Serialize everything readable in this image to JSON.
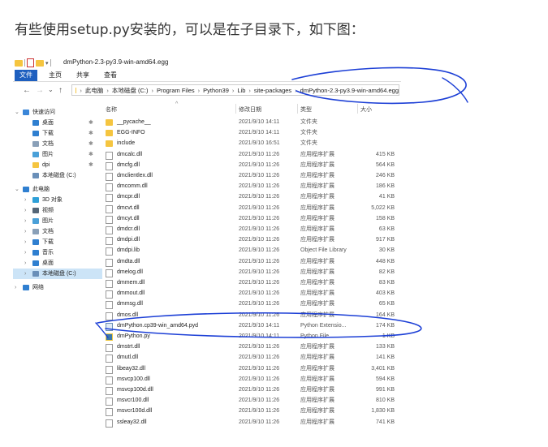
{
  "caption": "有些使用setup.py安装的，可以是在子目录下，如下图：",
  "window": {
    "title": "dmPython-2.3-py3.9-win-amd64.egg",
    "ribbon_tabs": [
      "文件",
      "主页",
      "共享",
      "查看"
    ],
    "nav_buttons": [
      "←",
      "→",
      "⌄",
      "↑"
    ],
    "breadcrumbs": [
      "此电脑",
      "本地磁盘 (C:)",
      "Program Files",
      "Python39",
      "Lib",
      "site-packages",
      "dmPython-2.3-py3.9-win-amd64.egg"
    ]
  },
  "nav_pane": [
    {
      "label": "快速访问",
      "icon": "star-icon",
      "color": "#3a86d8",
      "level": 0,
      "chev": "⌄"
    },
    {
      "label": "桌面",
      "icon": "desktop-icon",
      "color": "#2f7fd0",
      "level": 1,
      "pin": true
    },
    {
      "label": "下载",
      "icon": "download-icon",
      "color": "#2f7fd0",
      "level": 1,
      "pin": true
    },
    {
      "label": "文档",
      "icon": "document-icon",
      "color": "#8aa0b8",
      "level": 1,
      "pin": true
    },
    {
      "label": "图片",
      "icon": "pictures-icon",
      "color": "#4aa0d8",
      "level": 1,
      "pin": true
    },
    {
      "label": "dpi",
      "icon": "folder-icon",
      "color": "#f5c540",
      "level": 1,
      "pin": true
    },
    {
      "label": "本地磁盘 (C:)",
      "icon": "drive-icon",
      "color": "#6a8fb8",
      "level": 1
    },
    {
      "label": "此电脑",
      "icon": "computer-icon",
      "color": "#2f7fd0",
      "level": 0,
      "chev": "⌄"
    },
    {
      "label": "3D 对象",
      "icon": "3d-objects-icon",
      "color": "#2fa0d8",
      "level": 1,
      "chev": "›"
    },
    {
      "label": "视频",
      "icon": "video-icon",
      "color": "#556677",
      "level": 1,
      "chev": "›"
    },
    {
      "label": "图片",
      "icon": "pictures-icon",
      "color": "#4aa0d8",
      "level": 1,
      "chev": "›"
    },
    {
      "label": "文档",
      "icon": "document-icon",
      "color": "#8aa0b8",
      "level": 1,
      "chev": "›"
    },
    {
      "label": "下载",
      "icon": "download-icon",
      "color": "#2f7fd0",
      "level": 1,
      "chev": "›"
    },
    {
      "label": "音乐",
      "icon": "music-icon",
      "color": "#2f7fd0",
      "level": 1,
      "chev": "›"
    },
    {
      "label": "桌面",
      "icon": "desktop-icon",
      "color": "#2f7fd0",
      "level": 1,
      "chev": "›"
    },
    {
      "label": "本地磁盘 (C:)",
      "icon": "drive-icon",
      "color": "#6a8fb8",
      "level": 1,
      "chev": "›",
      "selected": true
    },
    {
      "label": "网络",
      "icon": "network-icon",
      "color": "#2f7fd0",
      "level": 0,
      "chev": "›"
    }
  ],
  "columns": {
    "name": "名称",
    "date": "修改日期",
    "type": "类型",
    "size": "大小"
  },
  "files": [
    {
      "name": "__pycache__",
      "date": "2021/9/10 14:11",
      "type": "文件夹",
      "size": "",
      "kind": "folder"
    },
    {
      "name": "EGG-INFO",
      "date": "2021/9/10 14:11",
      "type": "文件夹",
      "size": "",
      "kind": "folder"
    },
    {
      "name": "include",
      "date": "2021/9/10 16:51",
      "type": "文件夹",
      "size": "",
      "kind": "folder"
    },
    {
      "name": "dmcalc.dll",
      "date": "2021/9/10 11:26",
      "type": "应用程序扩展",
      "size": "415 KB",
      "kind": "file"
    },
    {
      "name": "dmcfg.dll",
      "date": "2021/9/10 11:26",
      "type": "应用程序扩展",
      "size": "564 KB",
      "kind": "file"
    },
    {
      "name": "dmclientlex.dll",
      "date": "2021/9/10 11:26",
      "type": "应用程序扩展",
      "size": "246 KB",
      "kind": "file"
    },
    {
      "name": "dmcomm.dll",
      "date": "2021/9/10 11:26",
      "type": "应用程序扩展",
      "size": "186 KB",
      "kind": "file"
    },
    {
      "name": "dmcpr.dll",
      "date": "2021/9/10 11:26",
      "type": "应用程序扩展",
      "size": "41 KB",
      "kind": "file"
    },
    {
      "name": "dmcvt.dll",
      "date": "2021/9/10 11:26",
      "type": "应用程序扩展",
      "size": "5,022 KB",
      "kind": "file"
    },
    {
      "name": "dmcyt.dll",
      "date": "2021/9/10 11:26",
      "type": "应用程序扩展",
      "size": "158 KB",
      "kind": "file"
    },
    {
      "name": "dmdcr.dll",
      "date": "2021/9/10 11:26",
      "type": "应用程序扩展",
      "size": "63 KB",
      "kind": "file"
    },
    {
      "name": "dmdpi.dll",
      "date": "2021/9/10 11:26",
      "type": "应用程序扩展",
      "size": "917 KB",
      "kind": "file"
    },
    {
      "name": "dmdpi.lib",
      "date": "2021/9/10 11:26",
      "type": "Object File Library",
      "size": "30 KB",
      "kind": "file"
    },
    {
      "name": "dmdta.dll",
      "date": "2021/9/10 11:26",
      "type": "应用程序扩展",
      "size": "448 KB",
      "kind": "file"
    },
    {
      "name": "dmelog.dll",
      "date": "2021/9/10 11:26",
      "type": "应用程序扩展",
      "size": "82 KB",
      "kind": "file"
    },
    {
      "name": "dmmem.dll",
      "date": "2021/9/10 11:26",
      "type": "应用程序扩展",
      "size": "83 KB",
      "kind": "file"
    },
    {
      "name": "dmmout.dll",
      "date": "2021/9/10 11:26",
      "type": "应用程序扩展",
      "size": "403 KB",
      "kind": "file"
    },
    {
      "name": "dmmsg.dll",
      "date": "2021/9/10 11:26",
      "type": "应用程序扩展",
      "size": "65 KB",
      "kind": "file"
    },
    {
      "name": "dmos.dll",
      "date": "2021/9/10 11:26",
      "type": "应用程序扩展",
      "size": "164 KB",
      "kind": "file"
    },
    {
      "name": "dmPython.cp39-win_amd64.pyd",
      "date": "2021/9/10 14:11",
      "type": "Python Extensio...",
      "size": "174 KB",
      "kind": "pyd"
    },
    {
      "name": "dmPython.py",
      "date": "2021/9/10 14:11",
      "type": "Python File",
      "size": "1 KB",
      "kind": "py"
    },
    {
      "name": "dmstrt.dll",
      "date": "2021/9/10 11:26",
      "type": "应用程序扩展",
      "size": "133 KB",
      "kind": "file"
    },
    {
      "name": "dmutl.dll",
      "date": "2021/9/10 11:26",
      "type": "应用程序扩展",
      "size": "141 KB",
      "kind": "file"
    },
    {
      "name": "libeay32.dll",
      "date": "2021/9/10 11:26",
      "type": "应用程序扩展",
      "size": "3,401 KB",
      "kind": "file"
    },
    {
      "name": "msvcp100.dll",
      "date": "2021/9/10 11:26",
      "type": "应用程序扩展",
      "size": "594 KB",
      "kind": "file"
    },
    {
      "name": "msvcp100d.dll",
      "date": "2021/9/10 11:26",
      "type": "应用程序扩展",
      "size": "991 KB",
      "kind": "file"
    },
    {
      "name": "msvcr100.dll",
      "date": "2021/9/10 11:26",
      "type": "应用程序扩展",
      "size": "810 KB",
      "kind": "file"
    },
    {
      "name": "msvcr100d.dll",
      "date": "2021/9/10 11:26",
      "type": "应用程序扩展",
      "size": "1,830 KB",
      "kind": "file"
    },
    {
      "name": "ssleay32.dll",
      "date": "2021/9/10 11:26",
      "type": "应用程序扩展",
      "size": "741 KB",
      "kind": "file"
    }
  ],
  "colors": {
    "ribbon_file_tab": "#1e5fbf",
    "annotation_ink": "#1c3fd6",
    "selection": "#cce4f7"
  }
}
